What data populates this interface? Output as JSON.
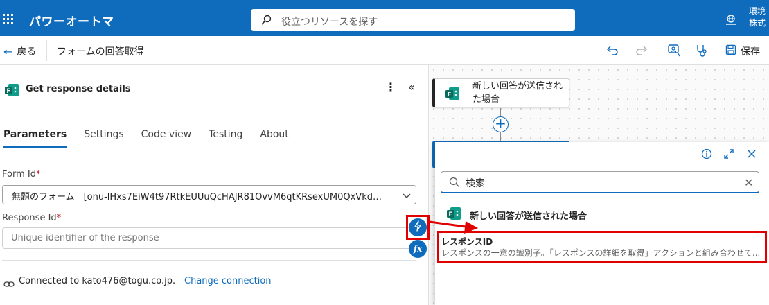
{
  "topbar": {
    "app_title": "パワーオートマ",
    "search_placeholder": "役立つリソースを探す",
    "environment_line1": "環境",
    "environment_line2": "株式"
  },
  "commandbar": {
    "back_label": "戻る",
    "flow_name": "フォームの回答取得",
    "save_label": "保存"
  },
  "panel": {
    "title": "Get response details",
    "tabs": [
      "Parameters",
      "Settings",
      "Code view",
      "Testing",
      "About"
    ],
    "active_tab": "Parameters",
    "form_id_label": "Form Id",
    "form_id_value": "無題のフォーム　[onu-lHxs7EiW4t97RtkEUUuQcHAJR81OvvM6qtKRsexUM0QxVkdMM...",
    "response_id_label": "Response Id",
    "response_id_placeholder": "Unique identifier of the response",
    "required_mark": "*",
    "connected_text": "Connected to kato476@togu.co.jp.",
    "change_connection": "Change connection"
  },
  "canvas": {
    "trigger_node_label": "新しい回答が送信された場合"
  },
  "dynamic_content": {
    "search_value": "検索",
    "group_title": "新しい回答が送信された場合",
    "items": [
      {
        "title": "レスポンスID",
        "description": "レスポンスの一意の識別子。「レスポンスの詳細を取得」アクションと組み合わせて..."
      }
    ]
  },
  "colors": {
    "brand": "#0f6cbd",
    "highlight": "#e00000",
    "forms_green": "#0b7a6a"
  }
}
